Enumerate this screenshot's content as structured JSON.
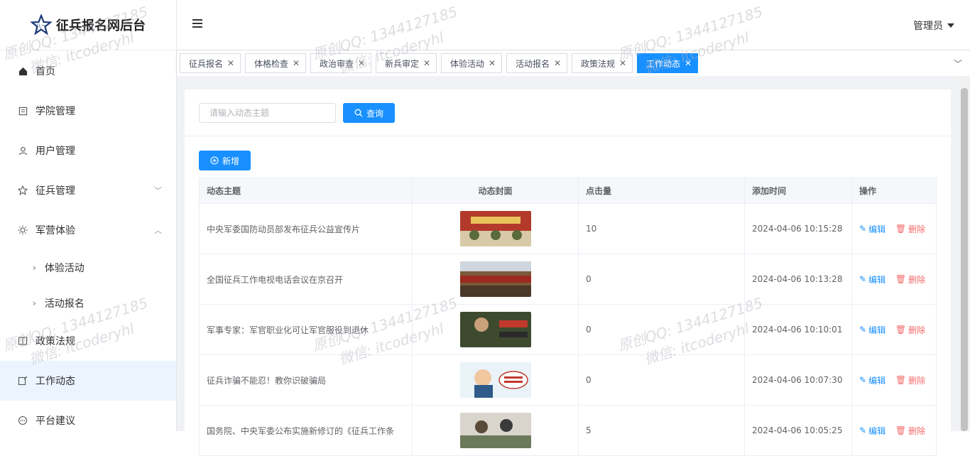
{
  "app": {
    "title": "征兵报名网后台"
  },
  "header": {
    "user_label": "管理员"
  },
  "sidebar": {
    "items": [
      {
        "label": "首页",
        "icon": "home-icon"
      },
      {
        "label": "学院管理",
        "icon": "document-icon"
      },
      {
        "label": "用户管理",
        "icon": "user-icon"
      },
      {
        "label": "征兵管理",
        "icon": "star-icon"
      },
      {
        "label": "军营体验",
        "icon": "sun-icon"
      },
      {
        "label": "政策法规",
        "icon": "book-icon"
      },
      {
        "label": "工作动态",
        "icon": "edit-icon"
      },
      {
        "label": "平台建议",
        "icon": "chat-icon"
      }
    ],
    "sub_items": [
      {
        "label": "体验活动"
      },
      {
        "label": "活动报名"
      }
    ]
  },
  "tabs": [
    {
      "label": "征兵报名"
    },
    {
      "label": "体格检查"
    },
    {
      "label": "政治审查"
    },
    {
      "label": "新兵审定"
    },
    {
      "label": "体验活动"
    },
    {
      "label": "活动报名"
    },
    {
      "label": "政策法规"
    },
    {
      "label": "工作动态"
    }
  ],
  "search": {
    "placeholder": "请输入动态主题",
    "button_label": "查询"
  },
  "add_button_label": "新增",
  "table": {
    "columns": [
      "动态主题",
      "动态封面",
      "点击量",
      "添加时间",
      "操作"
    ],
    "rows": [
      {
        "title": "中央军委国防动员部发布征兵公益宣传片",
        "clicks": "10",
        "time": "2024-04-06 10:15:28"
      },
      {
        "title": "全国征兵工作电视电话会议在京召开",
        "clicks": "0",
        "time": "2024-04-06 10:13:28"
      },
      {
        "title": "军事专家：军官职业化可让军官服役到退休",
        "clicks": "0",
        "time": "2024-04-06 10:10:01"
      },
      {
        "title": "征兵诈骗不能忍！教你识破骗局",
        "clicks": "0",
        "time": "2024-04-06 10:07:30"
      },
      {
        "title": "国务院、中央军委公布实施新修订的《征兵工作条",
        "clicks": "5",
        "time": "2024-04-06 10:05:25"
      }
    ],
    "edit_label": "编辑",
    "delete_label": "删除"
  },
  "watermark": {
    "line1": "原创QQ: 1344127185",
    "line2": "微信: itcoderyhl"
  },
  "colors": {
    "primary": "#1890ff",
    "danger": "#f56c6c",
    "active_menu_bg": "#ecf5ff"
  }
}
